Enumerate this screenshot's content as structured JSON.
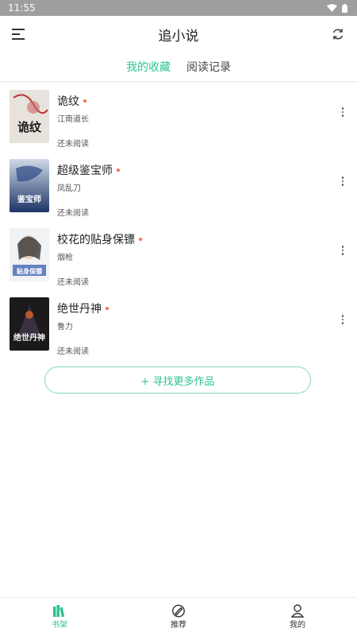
{
  "status": {
    "time": "11:55"
  },
  "header": {
    "title": "追小说"
  },
  "tabs": [
    {
      "label": "我的收藏",
      "active": true
    },
    {
      "label": "阅读记录",
      "active": false
    }
  ],
  "books": [
    {
      "title": "诡纹",
      "author": "江南道长",
      "progress": "还未阅读",
      "cover_text": "诡纹"
    },
    {
      "title": "超级鉴宝师",
      "author": "凤乱刀",
      "progress": "还未阅读",
      "cover_text": "超级鉴宝师"
    },
    {
      "title": "校花的贴身保镖",
      "author": "烟枪",
      "progress": "还未阅读",
      "cover_text": "校花的贴身保镖"
    },
    {
      "title": "绝世丹神",
      "author": "鲁力",
      "progress": "还未阅读",
      "cover_text": "绝世丹神"
    }
  ],
  "find_more": "+ 寻找更多作品",
  "bottom_nav": [
    {
      "label": "书架",
      "icon": "bookshelf-icon",
      "active": true
    },
    {
      "label": "推荐",
      "icon": "recommend-icon",
      "active": false
    },
    {
      "label": "我的",
      "icon": "user-icon",
      "active": false
    }
  ],
  "colors": {
    "accent": "#2fc392",
    "update_dot": "#ff6b4a",
    "statusbar": "#9e9e9e"
  }
}
